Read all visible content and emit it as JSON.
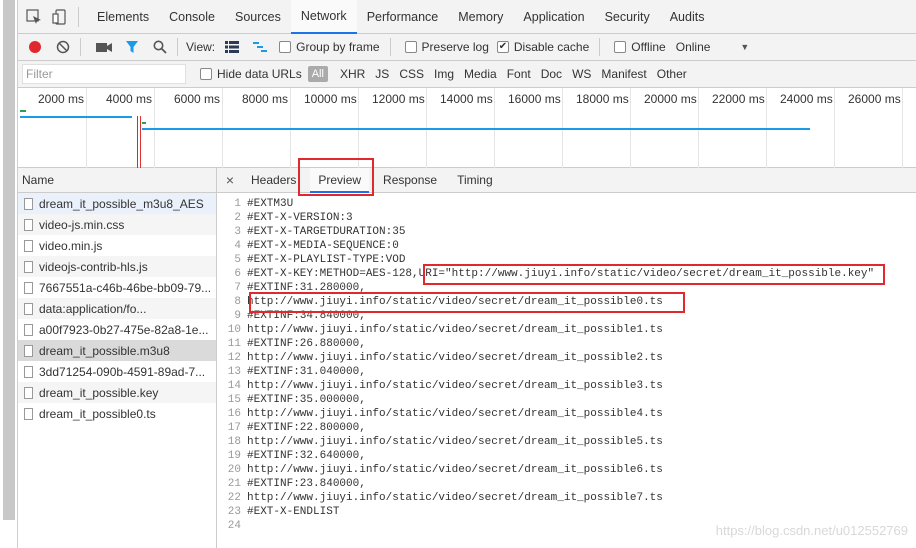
{
  "devtools": {
    "tabs": [
      "Elements",
      "Console",
      "Sources",
      "Network",
      "Performance",
      "Memory",
      "Application",
      "Security",
      "Audits"
    ],
    "active_tab": "Network"
  },
  "toolbar": {
    "view_label": "View:",
    "group_by_frame": "Group by frame",
    "preserve_log": "Preserve log",
    "disable_cache": "Disable cache",
    "offline": "Offline",
    "throttle": "Online"
  },
  "filter": {
    "placeholder": "Filter",
    "hide_data_urls": "Hide data URLs",
    "all": "All",
    "types": [
      "XHR",
      "JS",
      "CSS",
      "Img",
      "Media",
      "Font",
      "Doc",
      "WS",
      "Manifest",
      "Other"
    ]
  },
  "overview": {
    "ticks": [
      "2000 ms",
      "4000 ms",
      "6000 ms",
      "8000 ms",
      "10000 ms",
      "12000 ms",
      "14000 ms",
      "16000 ms",
      "18000 ms",
      "20000 ms",
      "22000 ms",
      "24000 ms",
      "26000 ms"
    ]
  },
  "requests": {
    "header": "Name",
    "items": [
      "dream_it_possible_m3u8_AES",
      "video-js.min.css",
      "video.min.js",
      "videojs-contrib-hls.js",
      "7667551a-c46b-46be-bb09-79...",
      "data:application/fo...",
      "a00f7923-0b27-475e-82a8-1e...",
      "dream_it_possible.m3u8",
      "3dd71254-090b-4591-89ad-7...",
      "dream_it_possible.key",
      "dream_it_possible0.ts"
    ]
  },
  "detail": {
    "tabs": [
      "Headers",
      "Preview",
      "Response",
      "Timing"
    ],
    "active": "Preview",
    "close": "×"
  },
  "preview": {
    "lines": [
      "#EXTM3U",
      "#EXT-X-VERSION:3",
      "#EXT-X-TARGETDURATION:35",
      "#EXT-X-MEDIA-SEQUENCE:0",
      "#EXT-X-PLAYLIST-TYPE:VOD",
      "#EXT-X-KEY:METHOD=AES-128,URI=\"http://www.jiuyi.info/static/video/secret/dream_it_possible.key\"",
      "#EXTINF:31.280000,",
      "http://www.jiuyi.info/static/video/secret/dream_it_possible0.ts",
      "#EXTINF:34.840000,",
      "http://www.jiuyi.info/static/video/secret/dream_it_possible1.ts",
      "#EXTINF:26.880000,",
      "http://www.jiuyi.info/static/video/secret/dream_it_possible2.ts",
      "#EXTINF:31.040000,",
      "http://www.jiuyi.info/static/video/secret/dream_it_possible3.ts",
      "#EXTINF:35.000000,",
      "http://www.jiuyi.info/static/video/secret/dream_it_possible4.ts",
      "#EXTINF:22.800000,",
      "http://www.jiuyi.info/static/video/secret/dream_it_possible5.ts",
      "#EXTINF:32.640000,",
      "http://www.jiuyi.info/static/video/secret/dream_it_possible6.ts",
      "#EXTINF:23.840000,",
      "http://www.jiuyi.info/static/video/secret/dream_it_possible7.ts",
      "#EXT-X-ENDLIST",
      ""
    ]
  },
  "watermark": "https://blog.csdn.net/u012552769",
  "colors": {
    "accent": "#1a73e8",
    "record": "#e0282e",
    "highlight": "#e0282e",
    "waterfall": "#1a9be8"
  }
}
